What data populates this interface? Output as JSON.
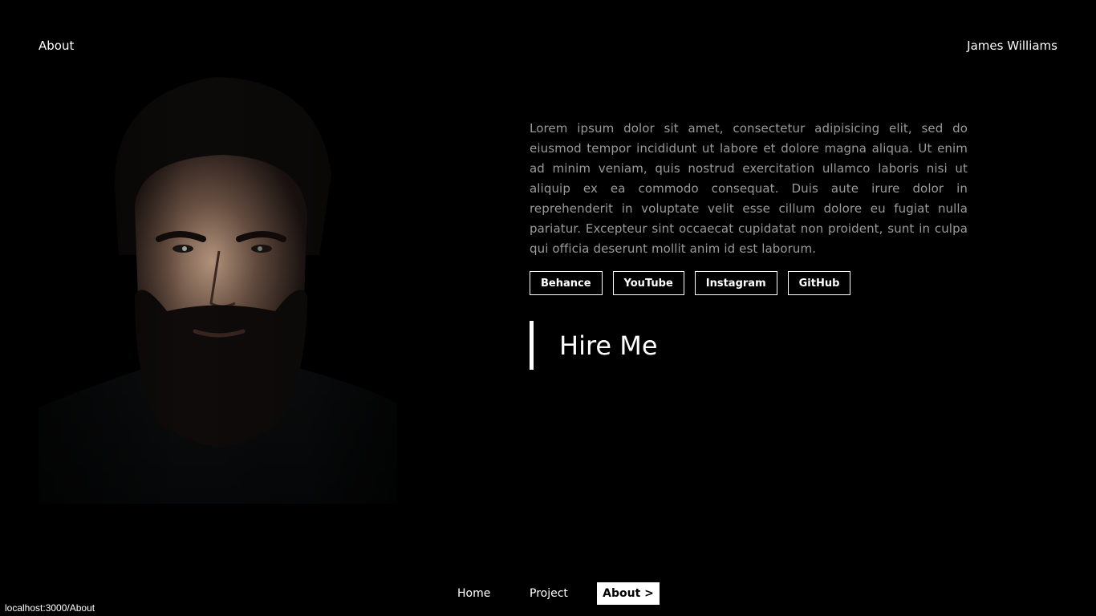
{
  "header": {
    "page_label": "About",
    "name": "James Williams"
  },
  "portrait": {
    "icon": "portrait-photo"
  },
  "bio": {
    "text": "Lorem ipsum dolor sit amet, consectetur adipisicing elit, sed do eiusmod tempor incididunt ut labore et dolore magna aliqua. Ut enim ad minim veniam, quis nostrud exercitation ullamco laboris nisi ut aliquip ex ea commodo consequat. Duis aute irure dolor in reprehenderit in voluptate velit esse cillum dolore eu fugiat nulla pariatur. Excepteur sint occaecat cupidatat non proident, sunt in culpa qui officia deserunt mollit anim id est laborum."
  },
  "socials": [
    {
      "label": "Behance"
    },
    {
      "label": "YouTube"
    },
    {
      "label": "Instagram"
    },
    {
      "label": "GitHub"
    }
  ],
  "hire": {
    "label": "Hire Me"
  },
  "nav": {
    "home": "Home",
    "project": "Project",
    "about": "About >"
  },
  "status_bar": {
    "url": "localhost:3000/About"
  },
  "colors": {
    "background": "#000000",
    "text": "#ffffff",
    "body_text": "#9a9a9a",
    "active_nav_bg": "#ffffff"
  }
}
